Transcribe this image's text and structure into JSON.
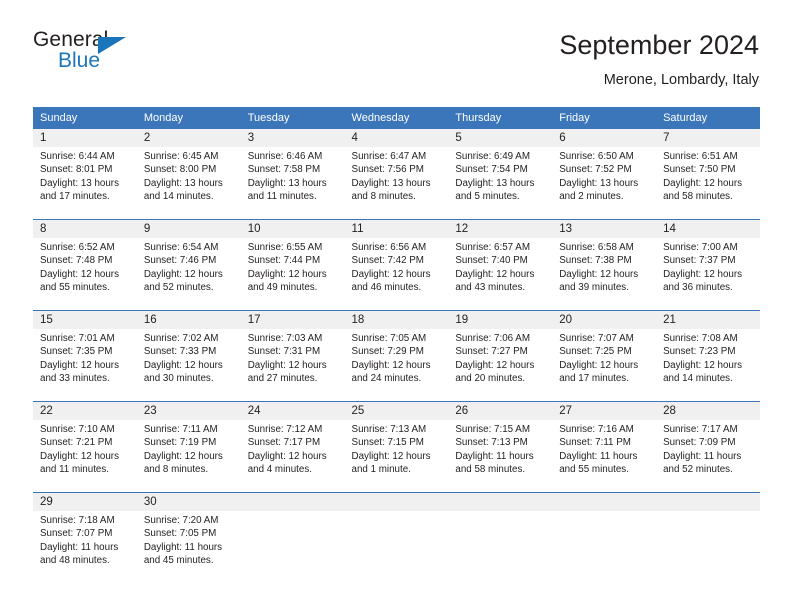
{
  "brand": {
    "word_one": "General",
    "word_two": "Blue",
    "accent_color": "#1b75bb"
  },
  "header": {
    "title": "September 2024",
    "subtitle": "Merone, Lombardy, Italy"
  },
  "calendar": {
    "header_bg": "#3b76bb",
    "day_band_bg": "#f0f0f0",
    "weekday_headers": [
      "Sunday",
      "Monday",
      "Tuesday",
      "Wednesday",
      "Thursday",
      "Friday",
      "Saturday"
    ],
    "weeks": [
      [
        {
          "date": "1",
          "sunrise": "Sunrise: 6:44 AM",
          "sunset": "Sunset: 8:01 PM",
          "daylight_line1": "Daylight: 13 hours",
          "daylight_line2": "and 17 minutes."
        },
        {
          "date": "2",
          "sunrise": "Sunrise: 6:45 AM",
          "sunset": "Sunset: 8:00 PM",
          "daylight_line1": "Daylight: 13 hours",
          "daylight_line2": "and 14 minutes."
        },
        {
          "date": "3",
          "sunrise": "Sunrise: 6:46 AM",
          "sunset": "Sunset: 7:58 PM",
          "daylight_line1": "Daylight: 13 hours",
          "daylight_line2": "and 11 minutes."
        },
        {
          "date": "4",
          "sunrise": "Sunrise: 6:47 AM",
          "sunset": "Sunset: 7:56 PM",
          "daylight_line1": "Daylight: 13 hours",
          "daylight_line2": "and 8 minutes."
        },
        {
          "date": "5",
          "sunrise": "Sunrise: 6:49 AM",
          "sunset": "Sunset: 7:54 PM",
          "daylight_line1": "Daylight: 13 hours",
          "daylight_line2": "and 5 minutes."
        },
        {
          "date": "6",
          "sunrise": "Sunrise: 6:50 AM",
          "sunset": "Sunset: 7:52 PM",
          "daylight_line1": "Daylight: 13 hours",
          "daylight_line2": "and 2 minutes."
        },
        {
          "date": "7",
          "sunrise": "Sunrise: 6:51 AM",
          "sunset": "Sunset: 7:50 PM",
          "daylight_line1": "Daylight: 12 hours",
          "daylight_line2": "and 58 minutes."
        }
      ],
      [
        {
          "date": "8",
          "sunrise": "Sunrise: 6:52 AM",
          "sunset": "Sunset: 7:48 PM",
          "daylight_line1": "Daylight: 12 hours",
          "daylight_line2": "and 55 minutes."
        },
        {
          "date": "9",
          "sunrise": "Sunrise: 6:54 AM",
          "sunset": "Sunset: 7:46 PM",
          "daylight_line1": "Daylight: 12 hours",
          "daylight_line2": "and 52 minutes."
        },
        {
          "date": "10",
          "sunrise": "Sunrise: 6:55 AM",
          "sunset": "Sunset: 7:44 PM",
          "daylight_line1": "Daylight: 12 hours",
          "daylight_line2": "and 49 minutes."
        },
        {
          "date": "11",
          "sunrise": "Sunrise: 6:56 AM",
          "sunset": "Sunset: 7:42 PM",
          "daylight_line1": "Daylight: 12 hours",
          "daylight_line2": "and 46 minutes."
        },
        {
          "date": "12",
          "sunrise": "Sunrise: 6:57 AM",
          "sunset": "Sunset: 7:40 PM",
          "daylight_line1": "Daylight: 12 hours",
          "daylight_line2": "and 43 minutes."
        },
        {
          "date": "13",
          "sunrise": "Sunrise: 6:58 AM",
          "sunset": "Sunset: 7:38 PM",
          "daylight_line1": "Daylight: 12 hours",
          "daylight_line2": "and 39 minutes."
        },
        {
          "date": "14",
          "sunrise": "Sunrise: 7:00 AM",
          "sunset": "Sunset: 7:37 PM",
          "daylight_line1": "Daylight: 12 hours",
          "daylight_line2": "and 36 minutes."
        }
      ],
      [
        {
          "date": "15",
          "sunrise": "Sunrise: 7:01 AM",
          "sunset": "Sunset: 7:35 PM",
          "daylight_line1": "Daylight: 12 hours",
          "daylight_line2": "and 33 minutes."
        },
        {
          "date": "16",
          "sunrise": "Sunrise: 7:02 AM",
          "sunset": "Sunset: 7:33 PM",
          "daylight_line1": "Daylight: 12 hours",
          "daylight_line2": "and 30 minutes."
        },
        {
          "date": "17",
          "sunrise": "Sunrise: 7:03 AM",
          "sunset": "Sunset: 7:31 PM",
          "daylight_line1": "Daylight: 12 hours",
          "daylight_line2": "and 27 minutes."
        },
        {
          "date": "18",
          "sunrise": "Sunrise: 7:05 AM",
          "sunset": "Sunset: 7:29 PM",
          "daylight_line1": "Daylight: 12 hours",
          "daylight_line2": "and 24 minutes."
        },
        {
          "date": "19",
          "sunrise": "Sunrise: 7:06 AM",
          "sunset": "Sunset: 7:27 PM",
          "daylight_line1": "Daylight: 12 hours",
          "daylight_line2": "and 20 minutes."
        },
        {
          "date": "20",
          "sunrise": "Sunrise: 7:07 AM",
          "sunset": "Sunset: 7:25 PM",
          "daylight_line1": "Daylight: 12 hours",
          "daylight_line2": "and 17 minutes."
        },
        {
          "date": "21",
          "sunrise": "Sunrise: 7:08 AM",
          "sunset": "Sunset: 7:23 PM",
          "daylight_line1": "Daylight: 12 hours",
          "daylight_line2": "and 14 minutes."
        }
      ],
      [
        {
          "date": "22",
          "sunrise": "Sunrise: 7:10 AM",
          "sunset": "Sunset: 7:21 PM",
          "daylight_line1": "Daylight: 12 hours",
          "daylight_line2": "and 11 minutes."
        },
        {
          "date": "23",
          "sunrise": "Sunrise: 7:11 AM",
          "sunset": "Sunset: 7:19 PM",
          "daylight_line1": "Daylight: 12 hours",
          "daylight_line2": "and 8 minutes."
        },
        {
          "date": "24",
          "sunrise": "Sunrise: 7:12 AM",
          "sunset": "Sunset: 7:17 PM",
          "daylight_line1": "Daylight: 12 hours",
          "daylight_line2": "and 4 minutes."
        },
        {
          "date": "25",
          "sunrise": "Sunrise: 7:13 AM",
          "sunset": "Sunset: 7:15 PM",
          "daylight_line1": "Daylight: 12 hours",
          "daylight_line2": "and 1 minute."
        },
        {
          "date": "26",
          "sunrise": "Sunrise: 7:15 AM",
          "sunset": "Sunset: 7:13 PM",
          "daylight_line1": "Daylight: 11 hours",
          "daylight_line2": "and 58 minutes."
        },
        {
          "date": "27",
          "sunrise": "Sunrise: 7:16 AM",
          "sunset": "Sunset: 7:11 PM",
          "daylight_line1": "Daylight: 11 hours",
          "daylight_line2": "and 55 minutes."
        },
        {
          "date": "28",
          "sunrise": "Sunrise: 7:17 AM",
          "sunset": "Sunset: 7:09 PM",
          "daylight_line1": "Daylight: 11 hours",
          "daylight_line2": "and 52 minutes."
        }
      ],
      [
        {
          "date": "29",
          "sunrise": "Sunrise: 7:18 AM",
          "sunset": "Sunset: 7:07 PM",
          "daylight_line1": "Daylight: 11 hours",
          "daylight_line2": "and 48 minutes."
        },
        {
          "date": "30",
          "sunrise": "Sunrise: 7:20 AM",
          "sunset": "Sunset: 7:05 PM",
          "daylight_line1": "Daylight: 11 hours",
          "daylight_line2": "and 45 minutes."
        },
        {
          "date": "",
          "sunrise": "",
          "sunset": "",
          "daylight_line1": "",
          "daylight_line2": ""
        },
        {
          "date": "",
          "sunrise": "",
          "sunset": "",
          "daylight_line1": "",
          "daylight_line2": ""
        },
        {
          "date": "",
          "sunrise": "",
          "sunset": "",
          "daylight_line1": "",
          "daylight_line2": ""
        },
        {
          "date": "",
          "sunrise": "",
          "sunset": "",
          "daylight_line1": "",
          "daylight_line2": ""
        },
        {
          "date": "",
          "sunrise": "",
          "sunset": "",
          "daylight_line1": "",
          "daylight_line2": ""
        }
      ]
    ]
  }
}
